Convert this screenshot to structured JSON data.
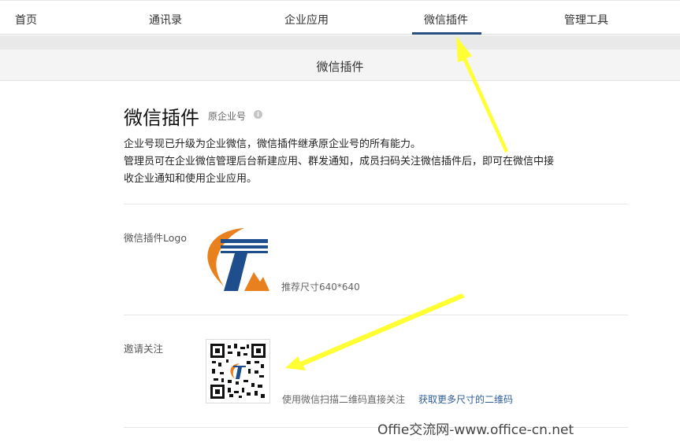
{
  "nav": {
    "items": [
      {
        "label": "首页"
      },
      {
        "label": "通讯录"
      },
      {
        "label": "企业应用"
      },
      {
        "label": "微信插件"
      },
      {
        "label": "管理工具"
      }
    ],
    "active_index": 3
  },
  "subheader": {
    "title": "微信插件"
  },
  "page": {
    "title": "微信插件",
    "subtitle": "原企业号",
    "description": [
      "企业号现已升级为企业微信，微信插件继承原企业号的所有能力。",
      "管理员可在企业微信管理后台新建应用、群发通知，成员扫码关注微信插件后，即可在微信中接",
      "收企业通知和使用企业应用。"
    ]
  },
  "logo_section": {
    "label": "微信插件Logo",
    "size_hint": "推荐尺寸640*640"
  },
  "invite_section": {
    "label": "邀请关注",
    "scan_hint": "使用微信扫描二维码直接关注",
    "more_sizes_link": "获取更多尺寸的二维码"
  },
  "watermark": "Offie交流网-www.office-cn.net",
  "colors": {
    "nav_active_underline": "#2b4d7e",
    "link": "#2f5e99",
    "arrow": "#ffff33",
    "logo_orange": "#e8801e",
    "logo_blue": "#1f4e8c"
  },
  "icons": [
    "info-icon",
    "company-logo",
    "qr-code",
    "yellow-arrow"
  ]
}
